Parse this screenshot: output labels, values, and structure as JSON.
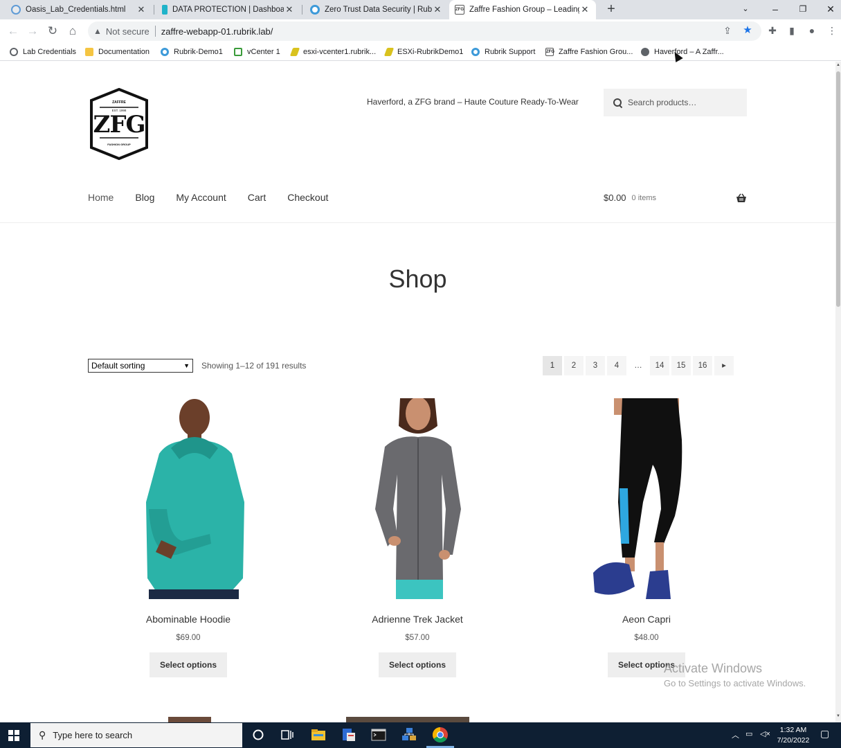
{
  "browser": {
    "tabs": [
      {
        "title": "Oasis_Lab_Credentials.html",
        "icon": "page-icon"
      },
      {
        "title": "DATA PROTECTION | Dashboard | ",
        "icon": "rubrik-icon"
      },
      {
        "title": "Zero Trust Data Security | Rubrik",
        "icon": "rubrik-gear-icon"
      },
      {
        "title": "Zaffre Fashion Group – Leading f",
        "icon": "zfg-icon"
      }
    ],
    "security_label": "Not secure",
    "url": "zaffre-webapp-01.rubrik.lab/",
    "bookmarks": [
      {
        "label": "Lab Credentials"
      },
      {
        "label": "Documentation"
      },
      {
        "label": "Rubrik-Demo1"
      },
      {
        "label": "vCenter 1"
      },
      {
        "label": "esxi-vcenter1.rubrik..."
      },
      {
        "label": "ESXi-RubrikDemo1"
      },
      {
        "label": "Rubrik Support"
      },
      {
        "label": "Zaffre Fashion Grou..."
      },
      {
        "label": "Haverford – A Zaffr..."
      }
    ]
  },
  "site": {
    "logo_text": "ZFG",
    "logo_top": "ZAFFRE",
    "logo_est": "EST. 1998",
    "logo_bottom": "FASHION GROUP",
    "tagline": "Haverford, a ZFG brand – Haute Couture Ready-To-Wear",
    "search_placeholder": "Search products…",
    "nav": [
      "Home",
      "Blog",
      "My Account",
      "Cart",
      "Checkout"
    ],
    "cart_amount": "$0.00",
    "cart_items": "0 items"
  },
  "shop": {
    "title": "Shop",
    "sorting": "Default sorting",
    "results": "Showing 1–12 of 191 results",
    "pages": [
      "1",
      "2",
      "3",
      "4",
      "…",
      "14",
      "15",
      "16"
    ],
    "next": "▸",
    "products": [
      {
        "name": "Abominable Hoodie",
        "price": "$69.00",
        "button": "Select options"
      },
      {
        "name": "Adrienne Trek Jacket",
        "price": "$57.00",
        "button": "Select options"
      },
      {
        "name": "Aeon Capri",
        "price": "$48.00",
        "button": "Select options"
      }
    ]
  },
  "watermark": {
    "line1": "Activate Windows",
    "line2": "Go to Settings to activate Windows."
  },
  "taskbar": {
    "search_placeholder": "Type here to search",
    "time": "1:32 AM",
    "date": "7/20/2022"
  }
}
